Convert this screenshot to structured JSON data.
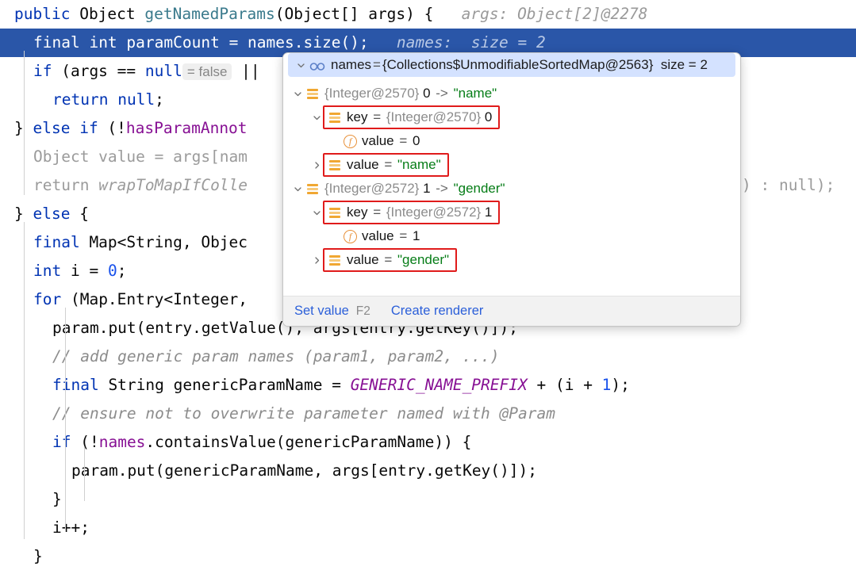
{
  "editor": {
    "lines": [
      {
        "id": "line-signature",
        "selected": false,
        "indent": 0,
        "tokens": [
          {
            "t": "public",
            "c": "kw"
          },
          {
            "t": " ",
            "c": "plain"
          },
          {
            "t": "Object",
            "c": "plain"
          },
          {
            "t": " ",
            "c": "plain"
          },
          {
            "t": "getNamedParams",
            "c": "type"
          },
          {
            "t": "(",
            "c": "plain"
          },
          {
            "t": "Object",
            "c": "plain"
          },
          {
            "t": "[] args) {",
            "c": "plain"
          },
          {
            "t": "   ",
            "c": "plain"
          },
          {
            "t": "args: Object[2]@2278",
            "c": "hint"
          }
        ]
      },
      {
        "id": "line-paramcount",
        "selected": true,
        "indent": 1,
        "tokens": [
          {
            "t": "final",
            "c": "kw"
          },
          {
            "t": " ",
            "c": "plain"
          },
          {
            "t": "int",
            "c": "kw"
          },
          {
            "t": " paramCount = names.size();",
            "c": "plain"
          },
          {
            "t": "   ",
            "c": "plain"
          },
          {
            "t": "names:  size = 2",
            "c": "hint"
          }
        ]
      },
      {
        "id": "line-if-args-null",
        "selected": false,
        "indent": 1,
        "tokens": [
          {
            "t": "if",
            "c": "kw"
          },
          {
            "t": " (args == ",
            "c": "plain"
          },
          {
            "t": "null",
            "c": "kw"
          },
          {
            "t": "= false",
            "c": "inlinehint"
          },
          {
            "t": " ||",
            "c": "plain"
          }
        ]
      },
      {
        "id": "line-return-null",
        "selected": false,
        "indent": 2,
        "tokens": [
          {
            "t": "return",
            "c": "kw"
          },
          {
            "t": " ",
            "c": "plain"
          },
          {
            "t": "null",
            "c": "kw"
          },
          {
            "t": ";",
            "c": "plain"
          }
        ]
      },
      {
        "id": "line-else-if-hasparam",
        "selected": false,
        "indent": 0,
        "tokens": [
          {
            "t": "} ",
            "c": "plain"
          },
          {
            "t": "else",
            "c": "kw"
          },
          {
            "t": " ",
            "c": "plain"
          },
          {
            "t": "if",
            "c": "kw"
          },
          {
            "t": " (!",
            "c": "plain"
          },
          {
            "t": "hasParamAnnot",
            "c": "field"
          }
        ]
      },
      {
        "id": "line-object-value",
        "selected": false,
        "indent": 1,
        "tokens": [
          {
            "t": "Object value = args[nam",
            "c": "dim"
          }
        ]
      },
      {
        "id": "line-return-wraptomap",
        "selected": false,
        "indent": 1,
        "tokens": [
          {
            "t": "return ",
            "c": "dim"
          },
          {
            "t": "wrapToMapIfColle",
            "c": "dim-i"
          }
        ],
        "tail": ") : null);"
      },
      {
        "id": "line-else",
        "selected": false,
        "indent": 0,
        "tokens": [
          {
            "t": "} ",
            "c": "plain"
          },
          {
            "t": "else",
            "c": "kw"
          },
          {
            "t": " {",
            "c": "plain"
          }
        ]
      },
      {
        "id": "line-final-map",
        "selected": false,
        "indent": 1,
        "tokens": [
          {
            "t": "final",
            "c": "kw"
          },
          {
            "t": " Map<String, Objec",
            "c": "plain"
          }
        ]
      },
      {
        "id": "line-int-i",
        "selected": false,
        "indent": 1,
        "tokens": [
          {
            "t": "int",
            "c": "kw"
          },
          {
            "t": " i = ",
            "c": "plain"
          },
          {
            "t": "0",
            "c": "num"
          },
          {
            "t": ";",
            "c": "plain"
          }
        ]
      },
      {
        "id": "line-for-entry",
        "selected": false,
        "indent": 1,
        "tokens": [
          {
            "t": "for",
            "c": "kw"
          },
          {
            "t": " (Map.Entry<Integer,",
            "c": "plain"
          }
        ]
      },
      {
        "id": "line-param-put-entry",
        "selected": false,
        "indent": 2,
        "tokens": [
          {
            "t": "param.put(entry.getValue(), args[entry.getKey()]);",
            "c": "plain"
          }
        ]
      },
      {
        "id": "line-comment-add-generic",
        "selected": false,
        "indent": 2,
        "tokens": [
          {
            "t": "// add generic param names (param1, param2, ...)",
            "c": "cmt"
          }
        ]
      },
      {
        "id": "line-generic-param-name",
        "selected": false,
        "indent": 2,
        "tokens": [
          {
            "t": "final",
            "c": "kw"
          },
          {
            "t": " String genericParamName = ",
            "c": "plain"
          },
          {
            "t": "GENERIC_NAME_PREFIX",
            "c": "static"
          },
          {
            "t": " + (i + ",
            "c": "plain"
          },
          {
            "t": "1",
            "c": "num"
          },
          {
            "t": ");",
            "c": "plain"
          }
        ]
      },
      {
        "id": "line-comment-ensure",
        "selected": false,
        "indent": 2,
        "tokens": [
          {
            "t": "// ensure not to overwrite parameter named with @Param",
            "c": "cmt"
          }
        ]
      },
      {
        "id": "line-if-contains-value",
        "selected": false,
        "indent": 2,
        "tokens": [
          {
            "t": "if",
            "c": "kw"
          },
          {
            "t": " (!",
            "c": "plain"
          },
          {
            "t": "names",
            "c": "field"
          },
          {
            "t": ".containsValue(genericParamName)) {",
            "c": "plain"
          }
        ]
      },
      {
        "id": "line-param-put-generic",
        "selected": false,
        "indent": 3,
        "tokens": [
          {
            "t": "param.put(genericParamName, args[entry.getKey()]);",
            "c": "plain"
          }
        ]
      },
      {
        "id": "line-close-if",
        "selected": false,
        "indent": 2,
        "tokens": [
          {
            "t": "}",
            "c": "plain"
          }
        ]
      },
      {
        "id": "line-i-increment",
        "selected": false,
        "indent": 2,
        "tokens": [
          {
            "t": "i++;",
            "c": "plain"
          }
        ]
      },
      {
        "id": "line-close-for",
        "selected": false,
        "indent": 1,
        "tokens": [
          {
            "t": "}",
            "c": "plain"
          }
        ]
      }
    ]
  },
  "popup": {
    "header": {
      "icon": "watch-glasses-icon",
      "expander": "chevron-down-icon",
      "name": "names",
      "equals": "=",
      "type": "{Collections$UnmodifiableSortedMap@2563}",
      "size": "size = 2"
    },
    "rows": [
      {
        "id": "entry-0",
        "depth": 1,
        "expander": "chevron-down-icon",
        "icon": "list-orange-icon",
        "boxed": false,
        "parts": [
          {
            "t": "{Integer@2570}",
            "c": "grayref"
          },
          {
            "t": " 0 ",
            "c": "numv"
          },
          {
            "t": "->",
            "c": "arrow"
          },
          {
            "t": " \"name\"",
            "c": "strv"
          }
        ]
      },
      {
        "id": "entry-0-key",
        "depth": 2,
        "expander": "chevron-down-icon",
        "icon": "list-orange-icon",
        "boxed": true,
        "parts": [
          {
            "t": "key",
            "c": "numv"
          },
          {
            "t": " = ",
            "c": "eq"
          },
          {
            "t": "{Integer@2570}",
            "c": "grayref"
          },
          {
            "t": " 0",
            "c": "numv"
          }
        ]
      },
      {
        "id": "entry-0-key-value",
        "depth": 3,
        "expander": "none",
        "icon": "field-f-icon",
        "boxed": false,
        "parts": [
          {
            "t": "value",
            "c": "numv"
          },
          {
            "t": " = ",
            "c": "eq"
          },
          {
            "t": "0",
            "c": "numv"
          }
        ]
      },
      {
        "id": "entry-0-value",
        "depth": 2,
        "expander": "chevron-right-icon",
        "icon": "list-orange-icon",
        "boxed": true,
        "parts": [
          {
            "t": "value",
            "c": "numv"
          },
          {
            "t": " = ",
            "c": "eq"
          },
          {
            "t": "\"name\"",
            "c": "strv"
          }
        ]
      },
      {
        "id": "entry-1",
        "depth": 1,
        "expander": "chevron-down-icon",
        "icon": "list-orange-icon",
        "boxed": false,
        "parts": [
          {
            "t": "{Integer@2572}",
            "c": "grayref"
          },
          {
            "t": " 1 ",
            "c": "numv"
          },
          {
            "t": "->",
            "c": "arrow"
          },
          {
            "t": " \"gender\"",
            "c": "strv"
          }
        ]
      },
      {
        "id": "entry-1-key",
        "depth": 2,
        "expander": "chevron-down-icon",
        "icon": "list-orange-icon",
        "boxed": true,
        "parts": [
          {
            "t": "key",
            "c": "numv"
          },
          {
            "t": " = ",
            "c": "eq"
          },
          {
            "t": "{Integer@2572}",
            "c": "grayref"
          },
          {
            "t": " 1",
            "c": "numv"
          }
        ]
      },
      {
        "id": "entry-1-key-value",
        "depth": 3,
        "expander": "none",
        "icon": "field-f-icon",
        "boxed": false,
        "parts": [
          {
            "t": "value",
            "c": "numv"
          },
          {
            "t": " = ",
            "c": "eq"
          },
          {
            "t": "1",
            "c": "numv"
          }
        ]
      },
      {
        "id": "entry-1-value",
        "depth": 2,
        "expander": "chevron-right-icon",
        "icon": "list-orange-icon",
        "boxed": true,
        "parts": [
          {
            "t": "value",
            "c": "numv"
          },
          {
            "t": " = ",
            "c": "eq"
          },
          {
            "t": "\"gender\"",
            "c": "strv"
          }
        ]
      }
    ],
    "footer": {
      "set_value_label": "Set value",
      "set_value_shortcut": "F2",
      "create_renderer_label": "Create renderer"
    }
  },
  "colors": {
    "selection_blue": "#2a56a8",
    "popup_header_blue": "#d4e2ff",
    "highlight_red": "#e01b1b",
    "icon_orange": "#f0a732",
    "string_green": "#067d17",
    "keyword_blue": "#0033b3",
    "field_purple": "#871094",
    "link_blue": "#2b5fd9"
  }
}
